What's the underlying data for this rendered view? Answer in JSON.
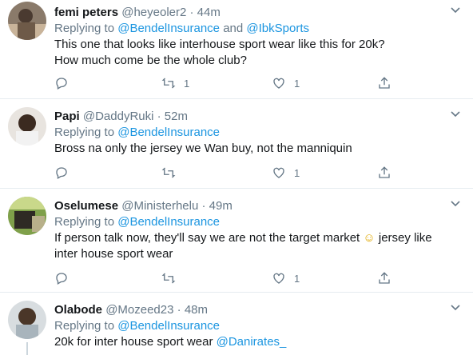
{
  "colors": {
    "link": "#1b95e0",
    "muted": "#657786",
    "text": "#14171a",
    "divider": "#e6ecf0"
  },
  "tweets": [
    {
      "name": "femi peters",
      "handle": "@heyeoler2",
      "separator": "·",
      "time": "44m",
      "replying_prefix": "Replying to ",
      "reply_to_1": "@BendelInsurance",
      "reply_and": " and ",
      "reply_to_2": "@IbkSports",
      "line1": "This one that looks like interhouse sport wear like this for 20k?",
      "line2": "How much come be the whole club?",
      "retweets": "1",
      "likes": "1"
    },
    {
      "name": "Papi",
      "handle": "@DaddyRuki",
      "separator": "·",
      "time": "52m",
      "replying_prefix": "Replying to ",
      "reply_to_1": "@BendelInsurance",
      "line1": "Bross na only the jersey we Wan buy, not the manniquin",
      "retweets": "",
      "likes": "1"
    },
    {
      "name": "Oselumese",
      "handle": "@Ministerhelu",
      "separator": "·",
      "time": "49m",
      "replying_prefix": "Replying to ",
      "reply_to_1": "@BendelInsurance",
      "line1a": "If person talk now, they'll say we are not the target market ",
      "emoji": "☺",
      "line1b": " jersey like",
      "line2": "inter house sport wear",
      "retweets": "",
      "likes": "1"
    },
    {
      "name": "Olabode",
      "handle": "@Mozeed23",
      "separator": "·",
      "time": "48m",
      "replying_prefix": "Replying to ",
      "reply_to_1": "@BendelInsurance",
      "line1": "20k for inter house sport wear ",
      "mention": "@Danirates_"
    }
  ]
}
